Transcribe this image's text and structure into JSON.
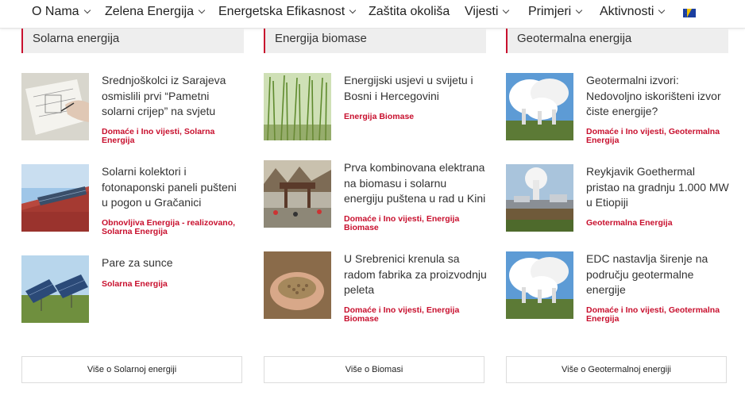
{
  "nav": {
    "items": [
      {
        "label": "O Nama",
        "dropdown": true
      },
      {
        "label": "Zelena Energija",
        "dropdown": true
      },
      {
        "label": "Energetska Efikasnost",
        "dropdown": true
      },
      {
        "label": "Zaštita okoliša",
        "dropdown": false
      },
      {
        "label": "Vijesti",
        "dropdown": true
      },
      {
        "label": "Primjeri",
        "dropdown": true
      },
      {
        "label": "Aktivnosti",
        "dropdown": true
      }
    ],
    "flag_icon": "bosnia-flag-icon"
  },
  "columns": [
    {
      "heading": "Solarna energija",
      "posts": [
        {
          "title": "Srednjoškolci iz Sarajeva osmislili prvi “Pametni solarni crijep” na svjetu",
          "category": "Domaće i Ino vijesti, Solarna Energija"
        },
        {
          "title": "Solarni kolektori i fotonaponski paneli pušteni u pogon u Gračanici",
          "category": "Obnovljiva Energija - realizovano, Solarna Energija"
        },
        {
          "title": "Pare za sunce",
          "category": "Solarna Energija"
        }
      ],
      "more_label": "Više o Solarnoj energiji"
    },
    {
      "heading": "Energija biomase",
      "posts": [
        {
          "title": "Energijski usjevi u svijetu i Bosni i Hercegovini",
          "category": "Energija Biomase"
        },
        {
          "title": "Prva kombinovana elektrana na biomasu i solarnu energiju puštena u rad u Kini",
          "category": "Domaće i Ino vijesti, Energija Biomase"
        },
        {
          "title": "U Srebrenici krenula sa radom fabrika za proizvodnju peleta",
          "category": "Domaće i Ino vijesti, Energija Biomase"
        }
      ],
      "more_label": "Više o Biomasi"
    },
    {
      "heading": "Geotermalna energija",
      "posts": [
        {
          "title": "Geotermalni izvori: Nedovoljno iskorišteni izvor čiste energije?",
          "category": "Domaće i Ino vijesti, Geotermalna Energija"
        },
        {
          "title": "Reykjavik Goethermal pristao na gradnju 1.000 MW u Etiopiji",
          "category": "Geotermalna Energija"
        },
        {
          "title": "EDC nastavlja širenje na području geotermalne energije",
          "category": "Domaće i Ino vijesti, Geotermalna Energija"
        }
      ],
      "more_label": "Više o Geotermalnoj energiji"
    }
  ],
  "colors": {
    "accent": "#c8102e",
    "heading_bg": "#eeeeee"
  }
}
